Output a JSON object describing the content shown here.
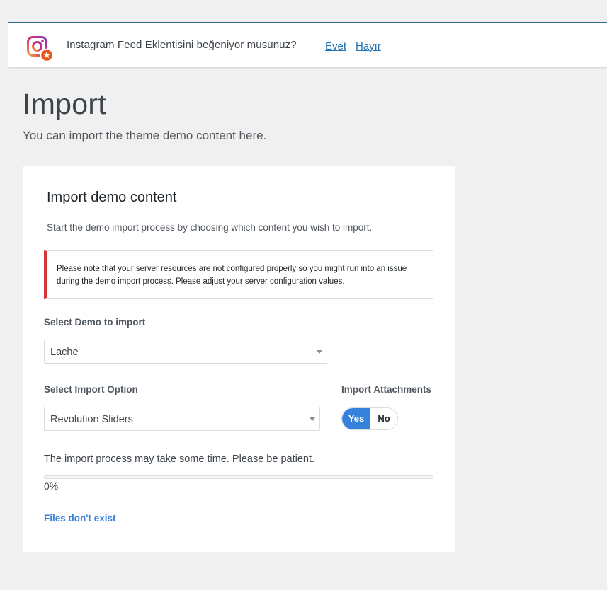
{
  "notice": {
    "message": "Instagram Feed Eklentisini beğeniyor musunuz?",
    "yes_label": "Evet",
    "no_label": "Hayır",
    "icon": "instagram-feed-logo-icon"
  },
  "page": {
    "title": "Import",
    "subtitle": "You can import the theme demo content here."
  },
  "card": {
    "title": "Import demo content",
    "description": "Start the demo import process by choosing which content you wish to import.",
    "warning": "Please note that your server resources are not configured properly so you might run into an issue during the demo import process. Please adjust your server configuration values.",
    "demo_label": "Select Demo to import",
    "demo_value": "Lache",
    "option_label": "Select Import Option",
    "option_value": "Revolution Sliders",
    "attachments_label": "Import Attachments",
    "toggle_yes": "Yes",
    "toggle_no": "No",
    "toggle_selected": "Yes",
    "patience": "The import process may take some time. Please be patient.",
    "progress_value": 0,
    "progress_text": "0%",
    "files_link": "Files don't exist"
  },
  "colors": {
    "accent": "#3582dd",
    "warning_border": "#d63638",
    "link": "#2271b1"
  }
}
